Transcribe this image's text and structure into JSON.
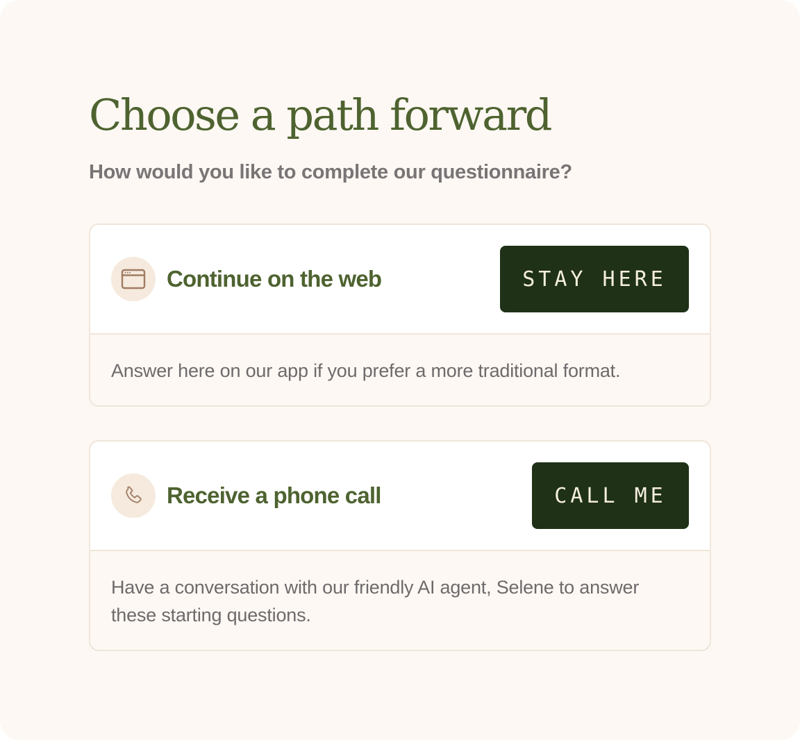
{
  "header": {
    "title": "Choose a path forward",
    "subtitle": "How would you like to complete our questionnaire?"
  },
  "options": [
    {
      "icon": "browser-window-icon",
      "title": "Continue on the web",
      "button_label": "STAY HERE",
      "description": "Answer here on our app if you prefer a more traditional format."
    },
    {
      "icon": "phone-icon",
      "title": "Receive a phone call",
      "button_label": "CALL ME",
      "description": "Have a conversation with our friendly AI agent, Selene to answer these starting questions."
    }
  ],
  "colors": {
    "background": "#fdf8f3",
    "accent_green": "#4e6330",
    "button_dark": "#1f3117",
    "icon_bg": "#f5eadd",
    "icon_stroke": "#a07c64",
    "border": "#efe5d9",
    "muted_text": "#6e6a6c"
  }
}
